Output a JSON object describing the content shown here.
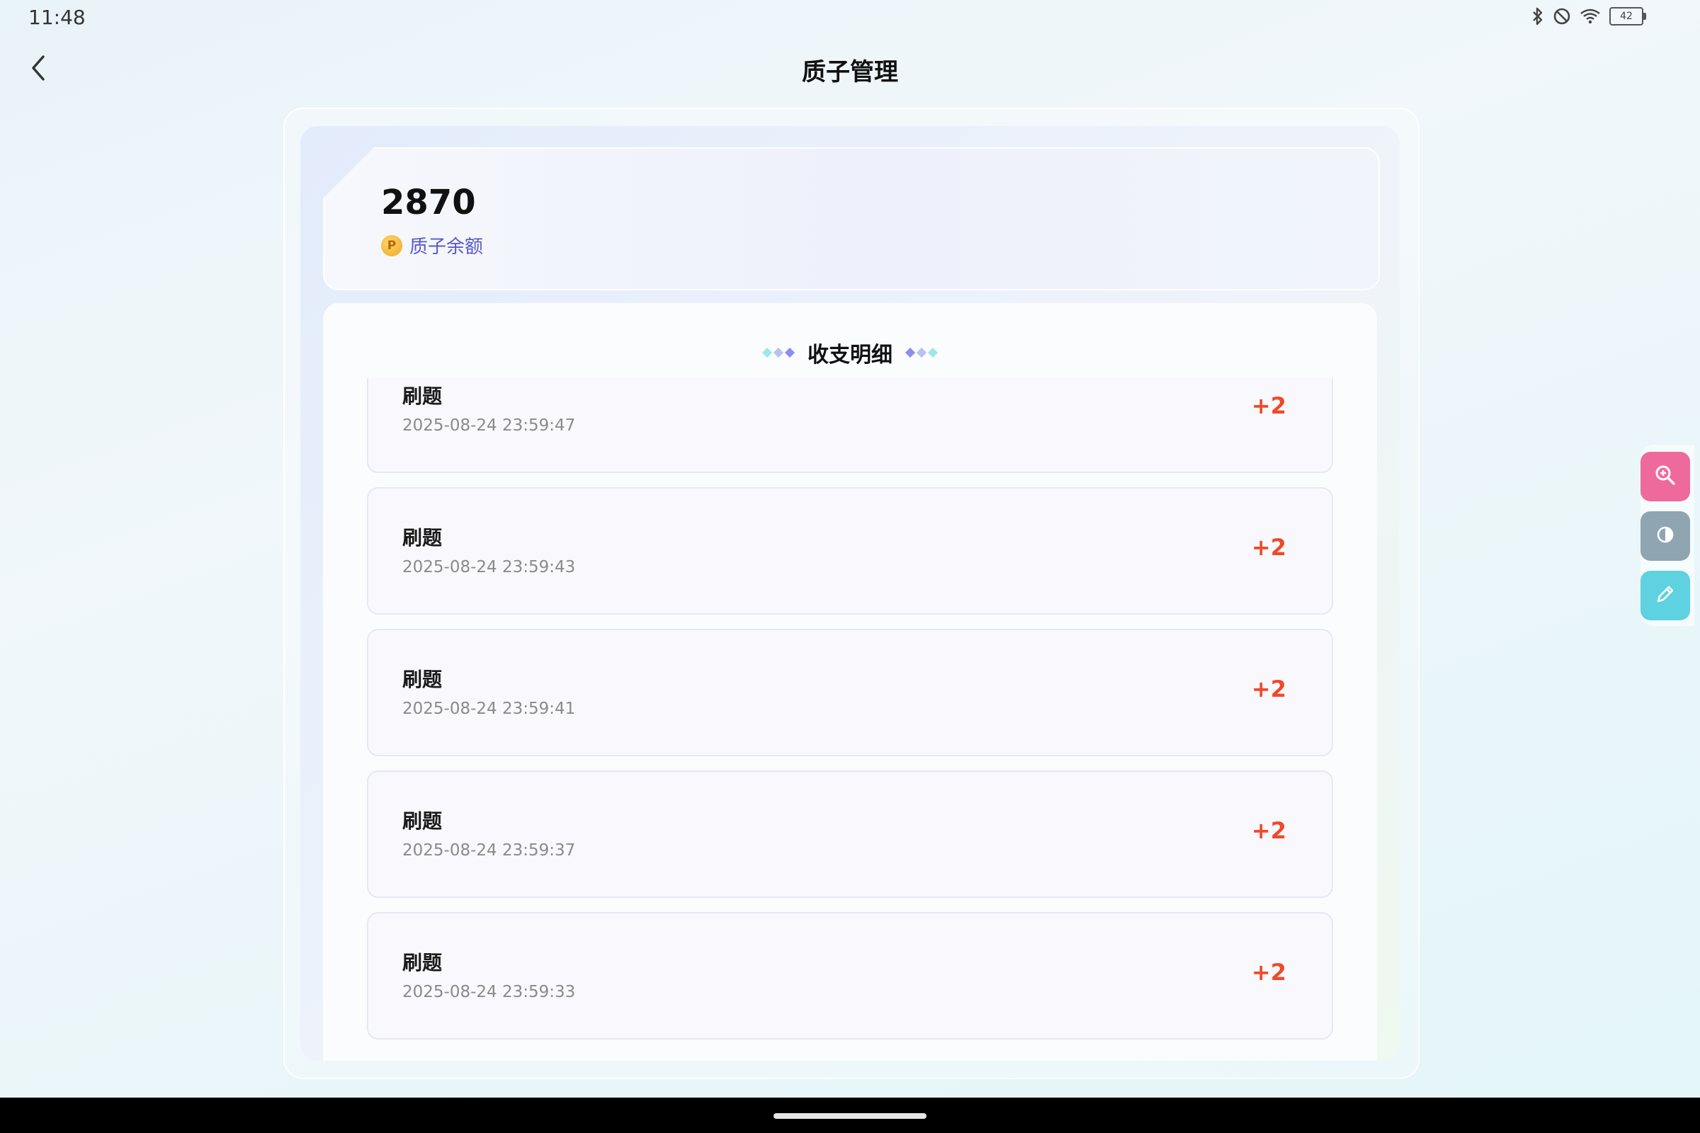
{
  "status_bar": {
    "time": "11:48",
    "battery_level": "42",
    "icons": [
      "bluetooth-icon",
      "do-not-disturb-icon",
      "wifi-icon",
      "battery-icon"
    ]
  },
  "header": {
    "title": "质子管理",
    "back_icon": "chevron-left-icon"
  },
  "balance": {
    "value": "2870",
    "label": "质子余额",
    "coin_glyph": "P"
  },
  "records": {
    "title": "收支明细",
    "items": [
      {
        "title": "刷题",
        "time": "2025-08-24 23:59:47",
        "amount": "+2"
      },
      {
        "title": "刷题",
        "time": "2025-08-24 23:59:43",
        "amount": "+2"
      },
      {
        "title": "刷题",
        "time": "2025-08-24 23:59:41",
        "amount": "+2"
      },
      {
        "title": "刷题",
        "time": "2025-08-24 23:59:37",
        "amount": "+2"
      },
      {
        "title": "刷题",
        "time": "2025-08-24 23:59:33",
        "amount": "+2"
      }
    ]
  },
  "side_tools": [
    {
      "icon": "zoom-in-icon",
      "color": "#ee6a9c"
    },
    {
      "icon": "contrast-icon",
      "color": "#8fa6b2"
    },
    {
      "icon": "pen-icon",
      "color": "#5ed2e0"
    }
  ],
  "colors": {
    "amount_positive": "#ef4a2a",
    "balance_label": "#5a59c7"
  }
}
